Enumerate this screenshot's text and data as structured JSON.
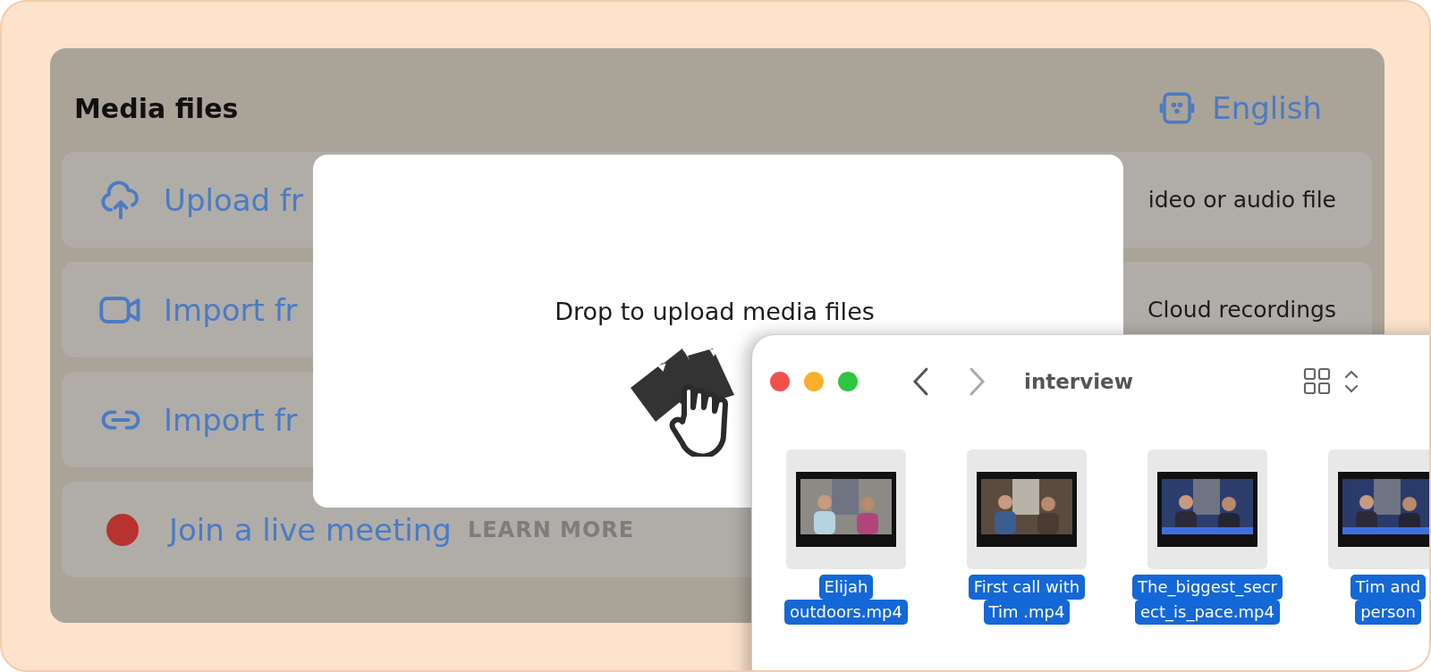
{
  "panel": {
    "title": "Media files",
    "language": "English"
  },
  "options": [
    {
      "kind": "upload",
      "label": "Upload fr",
      "detail": "ideo or audio file"
    },
    {
      "kind": "video",
      "label": "Import fr",
      "detail": "Cloud recordings"
    },
    {
      "kind": "link",
      "label": "Import fr"
    },
    {
      "kind": "live",
      "label": "Join a live meeting",
      "link": "LEARN MORE"
    }
  ],
  "drop_dialog": {
    "message": "Drop to upload media files"
  },
  "finder": {
    "title": "interview",
    "window_buttons": [
      {
        "color": "#f2514b"
      },
      {
        "color": "#f8b02c"
      },
      {
        "color": "#2ec540"
      }
    ],
    "files": [
      {
        "label_lines": [
          "Elijah",
          "outdoors.mp4"
        ],
        "selected": true
      },
      {
        "label_lines": [
          "First call with",
          "Tim .mp4"
        ],
        "selected": true
      },
      {
        "label_lines": [
          "The_biggest_secr",
          "ect_is_pace.mp4"
        ],
        "selected": true
      },
      {
        "label_lines": [
          "Tim and",
          "person"
        ],
        "selected": true
      }
    ]
  }
}
